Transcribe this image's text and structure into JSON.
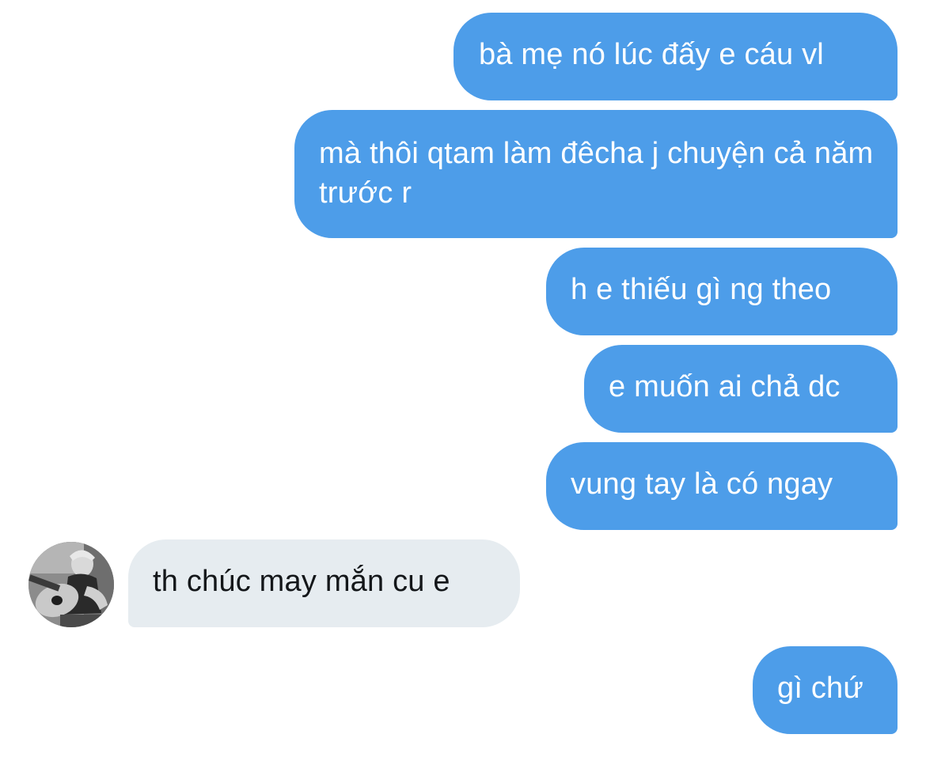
{
  "conversation": {
    "messages": [
      {
        "sender": "me",
        "text": "bà mẹ nó lúc đấy e cáu vl"
      },
      {
        "sender": "me",
        "text": "mà thôi qtam làm đêcha j chuyện cả năm trước r"
      },
      {
        "sender": "me",
        "text": "h e thiếu gì ng theo"
      },
      {
        "sender": "me",
        "text": "e muốn ai chả dc"
      },
      {
        "sender": "me",
        "text": "vung tay là có ngay"
      },
      {
        "sender": "other",
        "text": "th chúc may mắn cu e"
      },
      {
        "sender": "me",
        "text": "gì chứ"
      }
    ]
  },
  "colors": {
    "outgoing_bubble": "#4d9de9",
    "incoming_bubble": "#e6ecf0",
    "outgoing_text": "#ffffff",
    "incoming_text": "#14171a",
    "background": "#ffffff"
  },
  "icons": {
    "avatar": "profile-photo-avatar"
  }
}
